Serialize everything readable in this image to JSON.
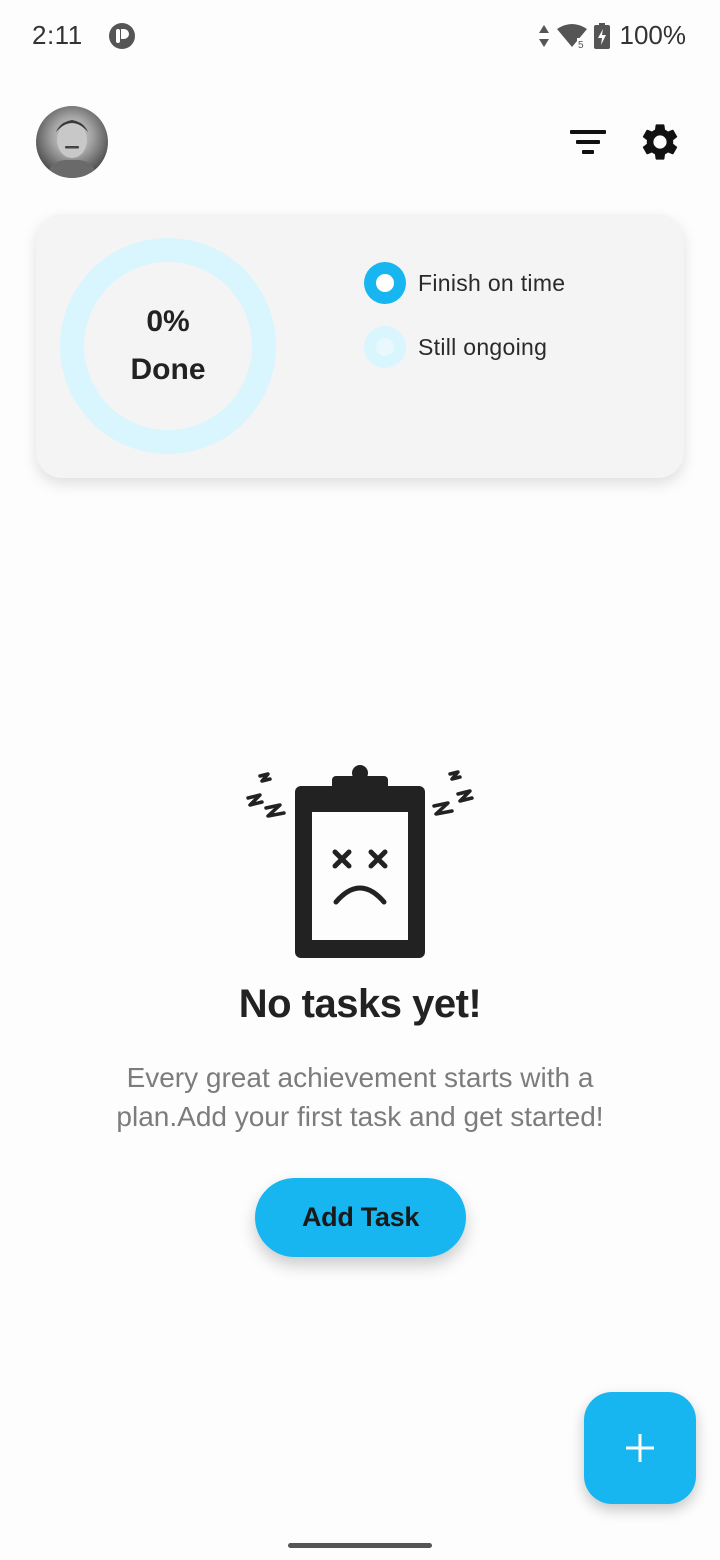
{
  "status_bar": {
    "time": "2:11",
    "battery": "100%",
    "icons": [
      "app-notification-icon",
      "data-arrows-icon",
      "wifi-icon",
      "battery-charging-icon"
    ]
  },
  "header": {
    "avatar": "profile-avatar",
    "icons": [
      "filter-icon",
      "gear-icon"
    ]
  },
  "progress": {
    "percent": 0,
    "percent_label": "0%",
    "done_label": "Done",
    "legend": [
      {
        "label": "Finish on time",
        "color": "#17b6f0"
      },
      {
        "label": "Still ongoing",
        "color": "#d9f5fd"
      }
    ]
  },
  "empty_state": {
    "illustration": "sad-clipboard-icon",
    "title": "No tasks yet!",
    "message": "Every great achievement starts with a plan.Add your first task and get started!",
    "button_label": "Add Task"
  },
  "fab": {
    "icon": "plus-icon"
  },
  "colors": {
    "accent": "#17b6f0",
    "accent_light": "#d9f5fd",
    "card_bg": "#f4f4f4",
    "text_muted": "#7c7c7c"
  }
}
